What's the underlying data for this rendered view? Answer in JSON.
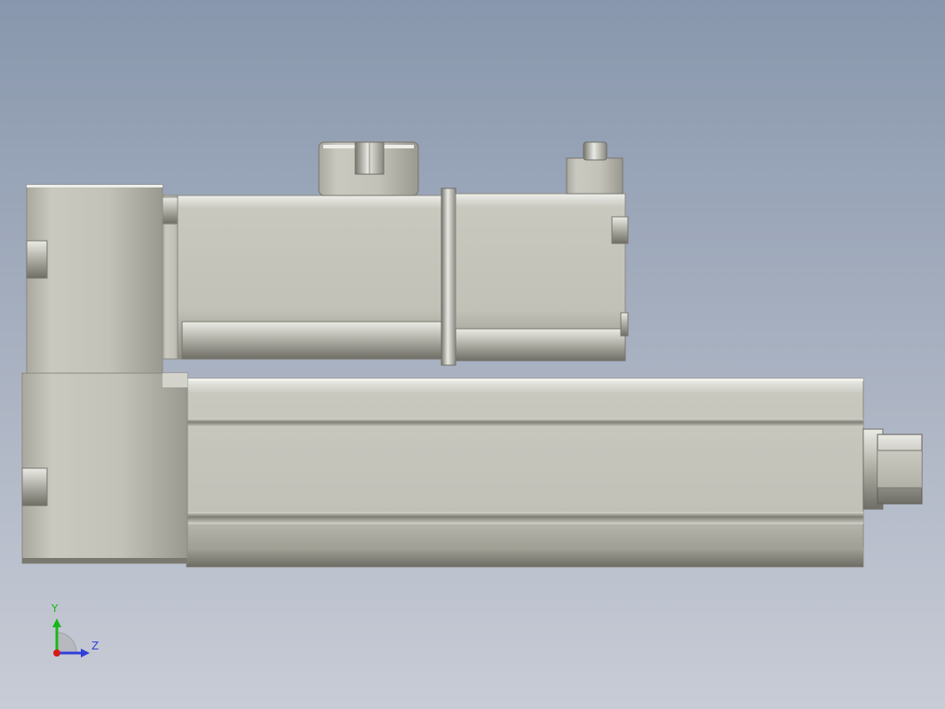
{
  "viewport": {
    "background_top": "#8897ad",
    "background_bottom": "#c8ccd6"
  },
  "model": {
    "body_color": "#c3c3b8",
    "shadow_color": "#7e7d73",
    "highlight_color": "#e3e3dd"
  },
  "triad": {
    "y_label": "Y",
    "z_label": "Z",
    "y_color": "#18b818",
    "z_color": "#2f3fd9",
    "x_color": "#d61a1a"
  }
}
